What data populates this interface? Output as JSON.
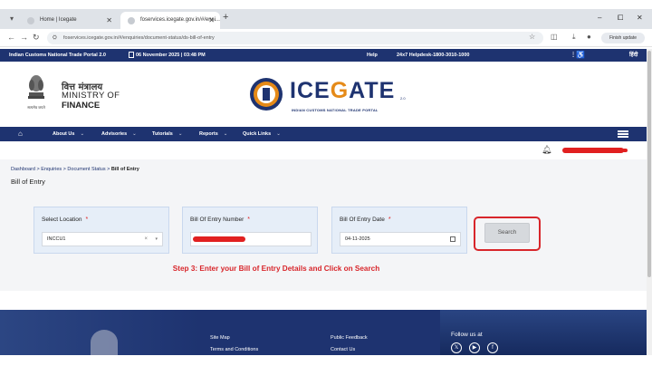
{
  "browser": {
    "tabs": [
      {
        "label": "Home | Icegate"
      },
      {
        "label": "foservices.icegate.gov.in/#/ensi..."
      }
    ],
    "new_tab_icon": "plus-icon",
    "window_controls": [
      "–",
      "⧠",
      "✕"
    ],
    "url": "foservices.icegate.gov.in/#/enquiries/document-status/ds-bill-of-entry",
    "finish_update_label": "Finish update"
  },
  "topbar": {
    "portal_name": "Indian Customs National Trade Portal 2.0",
    "date_time": "06 November 2025 | 03:48 PM",
    "help_label": "Help",
    "helpdesk_label": "24x7 Helpdesk-",
    "helpdesk_number": "1800-3010-1000",
    "language_label": "हिंदी"
  },
  "header": {
    "emblem_caption": "सत्यमेव जयते",
    "ministry_hindi": "वित्त मंत्रालय",
    "ministry_line1": "MINISTRY OF",
    "ministry_line2": "FINANCE",
    "logo_text_a": "ICE",
    "logo_text_b": "G",
    "logo_text_c": "ATE",
    "logo_version": "2.0",
    "logo_subtitle": "INDIAN CUSTOMS NATIONAL TRADE PORTAL"
  },
  "nav": {
    "items": [
      {
        "label": "About Us"
      },
      {
        "label": "Advisories"
      },
      {
        "label": "Tutorials"
      },
      {
        "label": "Reports"
      },
      {
        "label": "Quick Links"
      }
    ]
  },
  "breadcrumb": {
    "part1": "Dashboard",
    "part2": "Enquiries",
    "part3": "Document Status",
    "current": "Bill of Entry",
    "sep": ">"
  },
  "page_title": "Bill of Entry",
  "form": {
    "location": {
      "label": "Select Location",
      "value": "INCCU1"
    },
    "boe_number": {
      "label": "Bill Of Entry Number"
    },
    "boe_date": {
      "label": "Bill Of Entry Date",
      "value": "04-11-2025"
    },
    "required_mark": "*",
    "search_label": "Search"
  },
  "instruction": "Step 3: Enter your Bill of Entry Details and Click on Search",
  "footer": {
    "col1": [
      "Site Map",
      "Terms and Conditions"
    ],
    "col2": [
      "Public Feedback",
      "Contact Us"
    ],
    "follow_us": "Follow us at",
    "social": [
      "x-icon",
      "youtube-icon",
      "facebook-icon"
    ]
  },
  "colors": {
    "navy": "#1e3370",
    "accent_orange": "#e58a18",
    "highlight_red": "#d8262b"
  }
}
